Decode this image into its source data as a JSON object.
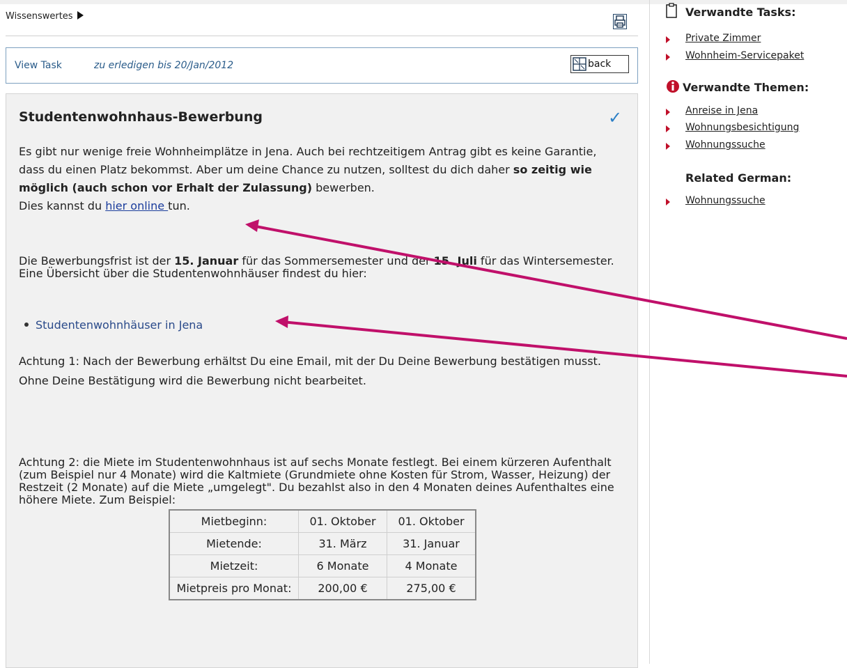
{
  "breadcrumb": {
    "label": "Wissenswertes"
  },
  "taskbar": {
    "view_task": "View Task",
    "due": "zu erledigen bis 20/Jan/2012",
    "back": "back"
  },
  "content": {
    "title": "Studentenwohnhaus-Bewerbung",
    "check_mark": "✓",
    "p1_a": "Es gibt nur wenige freie Wohnheimplätze in Jena. Auch bei rechtzeitigem Antrag gibt es keine Garantie, dass du einen Platz bekommst. Aber um deine Chance zu nutzen, solltest du dich daher ",
    "p1_bold": "so zeitig wie möglich (auch schon vor Erhalt der Zulassung)",
    "p1_b": " bewerben.",
    "p1_c": "Dies kannst du ",
    "p1_link": "hier online ",
    "p1_d": "tun.",
    "p2_a": "Die Bewerbungsfrist ist der ",
    "p2_bold1": "15. Januar",
    "p2_b": " für das Sommersemester und der ",
    "p2_bold2": "15. Juli",
    "p2_c": " für das Wintersemester.",
    "p2_d": "Eine Übersicht über die Studentenwohnhäuser findest du hier:",
    "bullet_link": "Studentenwohnhäuser in Jena",
    "p3": "Achtung 1: Nach der Bewerbung erhältst Du eine Email, mit der Du Deine Bewerbung bestätigen musst. Ohne Deine Bestätigung wird die Bewerbung nicht bearbeitet.",
    "p4": "Achtung 2: die Miete im Studentenwohnhaus ist auf sechs Monate festlegt. Bei einem kürzeren Aufenthalt (zum Beispiel nur 4 Monate) wird die Kaltmiete (Grundmiete ohne Kosten für Strom, Wasser, Heizung) der Restzeit (2 Monate) auf die Miete „umgelegt\". Du bezahlst also in den 4 Monaten deines Aufenthaltes eine höhere Miete. Zum Beispiel:",
    "table": [
      [
        "Mietbeginn:",
        "01. Oktober",
        "01. Oktober"
      ],
      [
        "Mietende:",
        "31. März",
        "31. Januar"
      ],
      [
        "Mietzeit:",
        "6 Monate",
        "4 Monate"
      ],
      [
        "Mietpreis pro Monat:",
        "200,00 €",
        "275,00 €"
      ]
    ]
  },
  "sidebar": {
    "tasks_title": "Verwandte Tasks:",
    "tasks": [
      "Private Zimmer",
      "Wohnheim-Servicepaket"
    ],
    "topics_title": "Verwandte Themen:",
    "topics": [
      "Anreise in Jena",
      "Wohnungsbesichtigung",
      "Wohnungssuche"
    ],
    "german_title": "Related German:",
    "german": [
      "Wohnungssuche"
    ]
  },
  "colors": {
    "annotation_arrow": "#c0106a",
    "link": "#1a3c9c",
    "accent": "#2a5c8a",
    "sidebar_bullet": "#c0102a"
  }
}
